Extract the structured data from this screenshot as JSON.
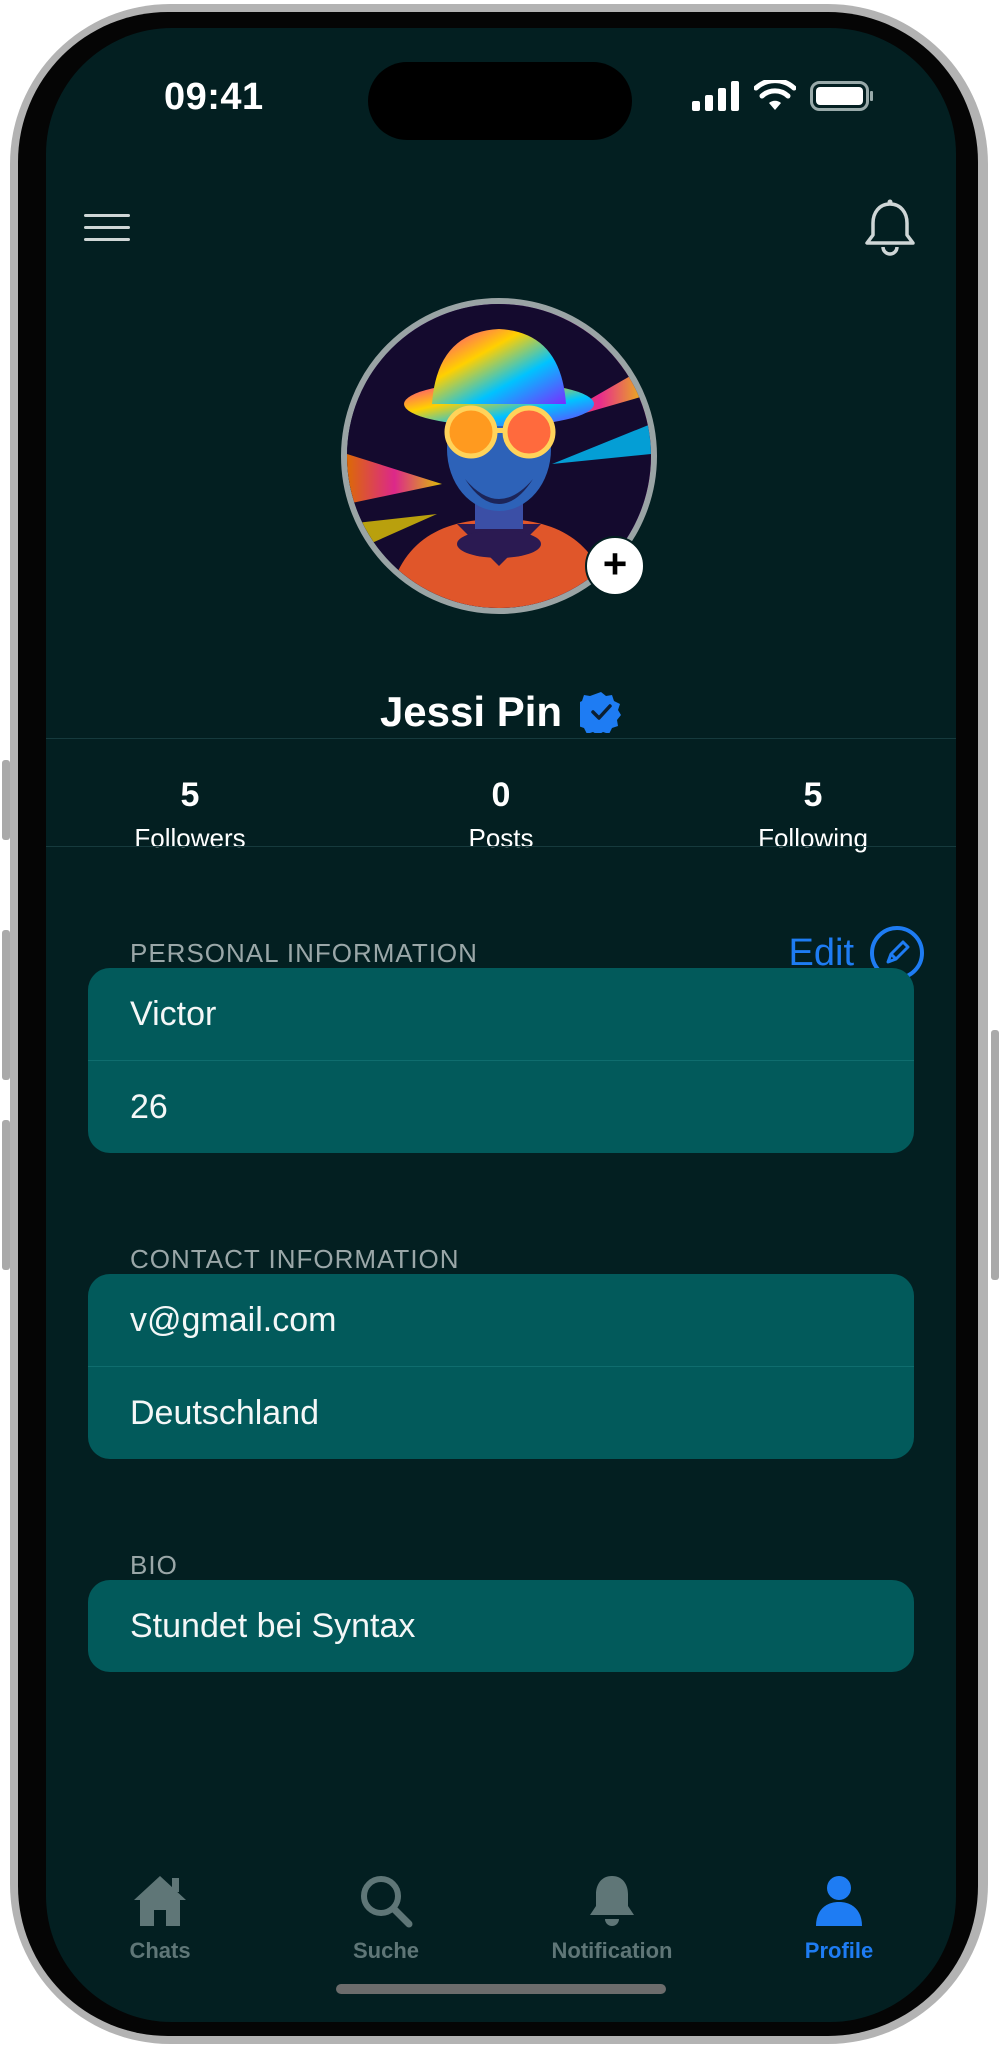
{
  "status_bar": {
    "time": "09:41"
  },
  "profile": {
    "name": "Jessi Pin",
    "verified_badge": "verified-badge-icon",
    "add_photo_label": "+"
  },
  "stats": [
    {
      "value": "5",
      "label": "Followers"
    },
    {
      "value": "0",
      "label": "Posts"
    },
    {
      "value": "5",
      "label": "Following"
    }
  ],
  "personal": {
    "title": "PERSONAL INFORMATION",
    "edit_label": "Edit",
    "rows": [
      "Victor",
      "26"
    ]
  },
  "contact": {
    "title": "CONTACT INFORMATION",
    "rows": [
      "v@gmail.com",
      "Deutschland"
    ]
  },
  "bio": {
    "title": "BIO",
    "rows": [
      "Stundet bei Syntax"
    ]
  },
  "tabs": [
    {
      "label": "Chats",
      "icon": "home-icon",
      "active": false
    },
    {
      "label": "Suche",
      "icon": "search-icon",
      "active": false
    },
    {
      "label": "Notification",
      "icon": "bell-icon",
      "active": false
    },
    {
      "label": "Profile",
      "icon": "person-icon",
      "active": true
    }
  ],
  "colors": {
    "background": "#031f21",
    "card": "#025a5b",
    "accent": "#1e7cf3",
    "inactive_tab": "#5f7677"
  }
}
